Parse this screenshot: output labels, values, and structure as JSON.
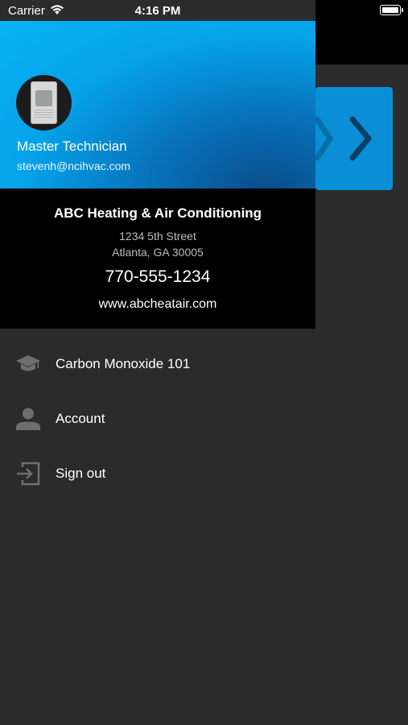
{
  "status_bar": {
    "carrier": "Carrier",
    "time": "4:16 PM"
  },
  "profile": {
    "role": "Master Technician",
    "email": "stevenh@ncihvac.com"
  },
  "company": {
    "name": "ABC Heating & Air Conditioning",
    "address_line1": "1234 5th Street",
    "address_line2": "Atlanta, GA 30005",
    "phone": "770-555-1234",
    "website": "www.abcheatair.com"
  },
  "menu": {
    "items": [
      {
        "label": "Carbon Monoxide 101",
        "icon": "graduation-cap-icon"
      },
      {
        "label": "Account",
        "icon": "person-icon"
      },
      {
        "label": "Sign out",
        "icon": "sign-out-icon"
      }
    ]
  },
  "colors": {
    "profile_gradient": "#08b4f5",
    "company_bg": "#000000",
    "drawer_bg": "#2b2b2b",
    "icon_gray": "#6e6e6e",
    "accent_card": "#0a8fd6"
  }
}
